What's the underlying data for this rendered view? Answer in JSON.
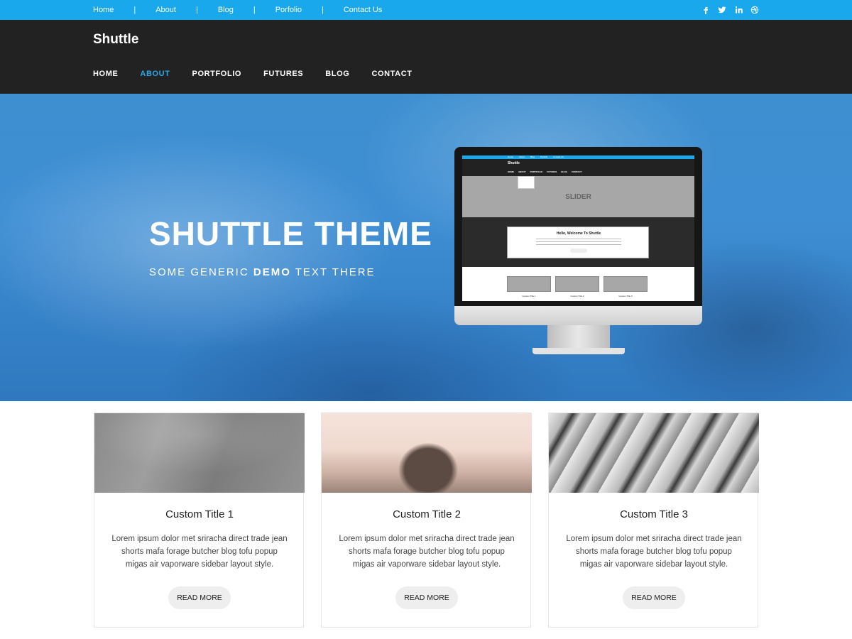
{
  "topbar": {
    "links": [
      {
        "label": "Home"
      },
      {
        "label": "About"
      },
      {
        "label": "Blog"
      },
      {
        "label": "Porfolio"
      },
      {
        "label": "Contact Us"
      }
    ],
    "separator": "|",
    "social": [
      "facebook-icon",
      "twitter-icon",
      "linkedin-icon",
      "dribbble-icon"
    ],
    "color": "#1aa8ec"
  },
  "header": {
    "site_title": "Shuttle",
    "nav": [
      {
        "label": "HOME"
      },
      {
        "label": "ABOUT",
        "active": true
      },
      {
        "label": "PORTFOLIO"
      },
      {
        "label": "FUTURES"
      },
      {
        "label": "BLOG"
      },
      {
        "label": "CONTACT"
      }
    ],
    "accent": "#29a8e6"
  },
  "hero": {
    "title": "SHUTTLE THEME",
    "subtitle_pre": "SOME GENERIC ",
    "subtitle_bold": "DEMO",
    "subtitle_post": " TEXT THERE",
    "monitor": {
      "top_links": [
        "Home",
        "About",
        "Blog",
        "Porfolio",
        "Contact Us"
      ],
      "brand": "Shuttle",
      "nav": [
        "HOME",
        "ABOUT",
        "PORTFOLIO",
        "FUTURES",
        "BLOG",
        "CONTACT"
      ],
      "slider_label": "SLIDER",
      "welcome_title": "Hello, Welcome To Shuttle",
      "cards": [
        "Custom Title 1",
        "Custom Title 2",
        "Custom Title 3"
      ]
    }
  },
  "cards": [
    {
      "title": "Custom Title 1",
      "text": "Lorem ipsum dolor met sriracha direct trade jean shorts mafa forage butcher blog tofu popup migas air vaporware sidebar layout style.",
      "button": "READ MORE"
    },
    {
      "title": "Custom Title 2",
      "text": "Lorem ipsum dolor met sriracha direct trade jean shorts mafa forage butcher blog tofu popup migas air vaporware sidebar layout style.",
      "button": "READ MORE"
    },
    {
      "title": "Custom Title 3",
      "text": "Lorem ipsum dolor met sriracha direct trade jean shorts mafa forage butcher blog tofu popup migas air vaporware sidebar layout style.",
      "button": "READ MORE"
    }
  ]
}
